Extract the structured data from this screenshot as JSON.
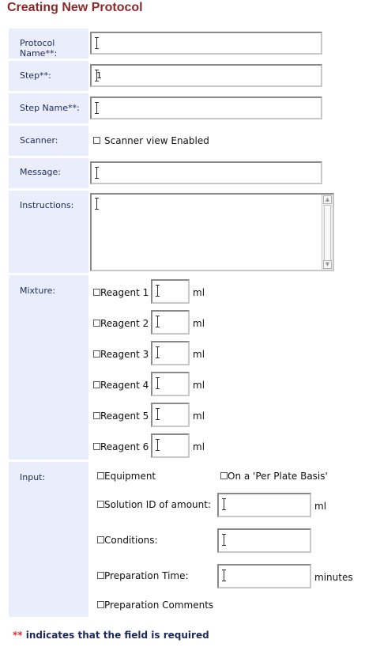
{
  "page_title": "Creating New Protocol",
  "required_marker": "**",
  "fields": {
    "protocol_name": {
      "label": "Protocol Name",
      "value": ""
    },
    "step": {
      "label": "Step",
      "value": "1"
    },
    "step_name": {
      "label": "Step Name",
      "value": ""
    },
    "scanner": {
      "label": "Scanner:",
      "checkbox_label": "Scanner view Enabled"
    },
    "message": {
      "label": "Message:",
      "value": ""
    },
    "instructions": {
      "label": "Instructions:",
      "value": ""
    }
  },
  "mixture": {
    "label": "Mixture:",
    "unit": "ml",
    "reagents": [
      {
        "label": "Reagent 1",
        "value": ""
      },
      {
        "label": "Reagent 2",
        "value": ""
      },
      {
        "label": "Reagent 3",
        "value": ""
      },
      {
        "label": "Reagent 4",
        "value": ""
      },
      {
        "label": "Reagent 5",
        "value": ""
      },
      {
        "label": "Reagent 6",
        "value": ""
      }
    ]
  },
  "input": {
    "label": "Input:",
    "equipment": "Equipment",
    "per_plate": "On a 'Per Plate Basis'",
    "solution": "Solution ID of amount:",
    "solution_unit": "ml",
    "conditions": "Conditions:",
    "prep_time": "Preparation Time:",
    "prep_time_unit": "minutes",
    "prep_comments": "Preparation Comments"
  },
  "footer": {
    "marker": "**",
    "text": " indicates that the field is required"
  }
}
